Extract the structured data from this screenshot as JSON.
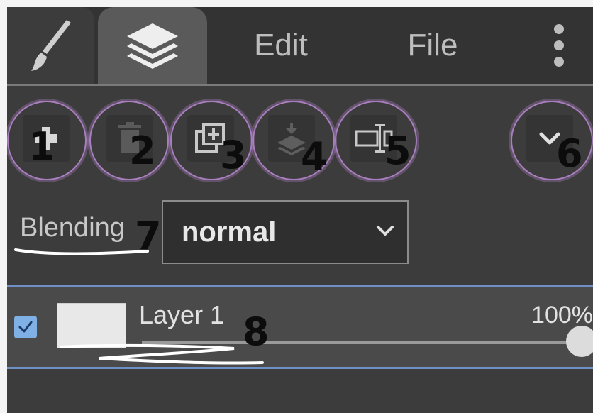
{
  "tabs": {
    "brush_icon": "paintbrush-icon",
    "layers_icon": "layers-icon",
    "edit_label": "Edit",
    "file_label": "File",
    "more_icon": "kebab-menu-icon"
  },
  "toolbar": {
    "buttons": [
      {
        "icon": "add-layer-icon",
        "annotation": "1"
      },
      {
        "icon": "trash-icon",
        "annotation": "2"
      },
      {
        "icon": "duplicate-layer-icon",
        "annotation": "3"
      },
      {
        "icon": "merge-down-icon",
        "annotation": "4"
      },
      {
        "icon": "rename-layer-icon",
        "annotation": "5"
      },
      {
        "icon": "chevron-down-icon",
        "annotation": "6"
      }
    ]
  },
  "blending": {
    "label": "Blending",
    "value": "normal",
    "annotation": "7"
  },
  "layer": {
    "name": "Layer 1",
    "opacity_label": "100%",
    "opacity": 1.0,
    "visible": true,
    "annotation": "8"
  },
  "colors": {
    "panel": "#3c3c3c",
    "accent_blue": "#6f8fc7",
    "annotation_ring": "#a97fbf",
    "checkbox": "#7fb0e6"
  }
}
